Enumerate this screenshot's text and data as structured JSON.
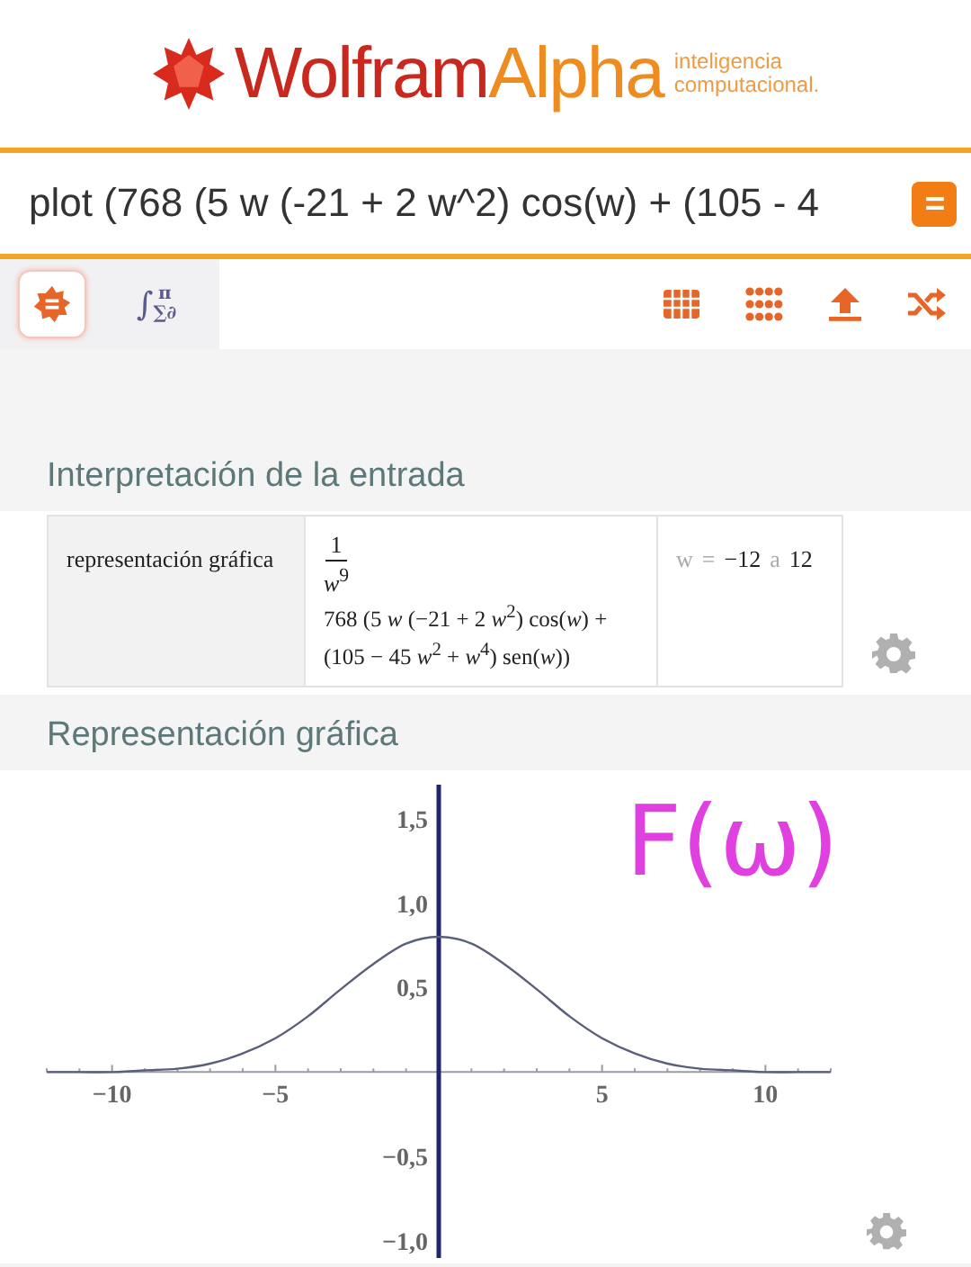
{
  "logo": {
    "word_1": "Wolfram",
    "word_2": "Alpha",
    "tagline": [
      "inteligencia",
      "computacional."
    ]
  },
  "query": {
    "value": "plot (768 (5 w (-21 + 2 w^2) cos(w) + (105 - 4"
  },
  "modes": [
    {
      "kind": "natural",
      "selected": true
    },
    {
      "kind": "math",
      "glyph": "∫",
      "sup": "π",
      "sub": "∑∂",
      "selected": false
    }
  ],
  "tools": [
    {
      "kind": "table"
    },
    {
      "kind": "keypad"
    },
    {
      "kind": "upload"
    },
    {
      "kind": "shuffle"
    }
  ],
  "interpretation": {
    "title": "Interpretación de la entrada",
    "label": "representación gráfica",
    "fraction": {
      "numerator": "1",
      "denominator": "*w*$^{9}$"
    },
    "lines": [
      "768 (5 *w* (−21 + 2 *w*$^{2}$) cos(*w*) +",
      "(105 − 45 *w*$^{2}$ + *w*$^{4}$) sen(*w*))"
    ],
    "range": [
      {
        "text": "w",
        "muted": true
      },
      {
        "text": "=",
        "muted": true
      },
      {
        "text": "−12",
        "muted": false
      },
      {
        "text": "a",
        "muted": true
      },
      {
        "text": "12",
        "muted": false
      }
    ]
  },
  "plot": {
    "title": "Representación gráfica",
    "annotation": "F(ω)",
    "chart_data": {
      "type": "line",
      "x": [
        -12,
        -11,
        -10,
        -9,
        -8,
        -7,
        -6,
        -5,
        -4,
        -3,
        -2,
        -1,
        0,
        1,
        2,
        3,
        4,
        5,
        6,
        7,
        8,
        9,
        10,
        11,
        12
      ],
      "series": [
        {
          "color": "#5a5f7a",
          "values": [
            0,
            0,
            0,
            0.01,
            0.02,
            0.05,
            0.11,
            0.2,
            0.33,
            0.49,
            0.64,
            0.76,
            0.8,
            0.76,
            0.64,
            0.49,
            0.33,
            0.2,
            0.11,
            0.05,
            0.02,
            0.01,
            0,
            0,
            0
          ]
        }
      ],
      "xlim": [
        -12,
        12
      ],
      "ylim": [
        -1.1,
        1.7
      ],
      "xticks": [
        {
          "value": -10,
          "label": "−10"
        },
        {
          "value": -5,
          "label": "−5"
        },
        {
          "value": 5,
          "label": "5"
        },
        {
          "value": 10,
          "label": "10"
        }
      ],
      "yticks": [
        {
          "value": 1.5,
          "label": "1,5"
        },
        {
          "value": 1.0,
          "label": "1,0"
        },
        {
          "value": 0.5,
          "label": "0,5"
        },
        {
          "value": -0.5,
          "label": "−0,5"
        },
        {
          "value": -1.0,
          "label": "−1,0"
        }
      ]
    }
  }
}
